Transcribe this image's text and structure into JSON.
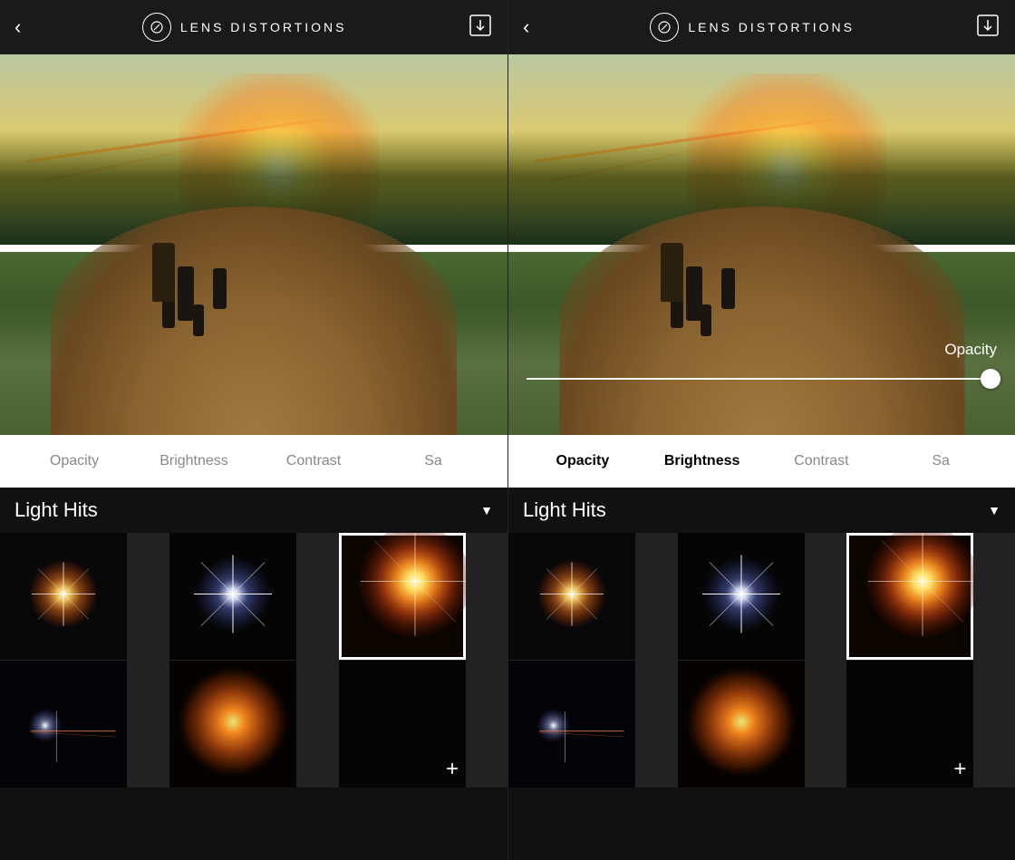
{
  "panels": [
    {
      "id": "panel-left",
      "header": {
        "back_label": "‹",
        "logo_icon": "✕",
        "title": "LENS DISTORTIONS",
        "download_icon": "⬇"
      },
      "controls": {
        "items": [
          {
            "label": "Opacity",
            "active": false
          },
          {
            "label": "Brightness",
            "active": false
          },
          {
            "label": "Contrast",
            "active": false
          },
          {
            "label": "Sa",
            "active": false
          }
        ]
      },
      "light_hits": {
        "title": "Light Hits",
        "dropdown_icon": "▼"
      },
      "thumbnails": [
        {
          "id": 1,
          "type": "small-star-warm",
          "selected": false
        },
        {
          "id": 2,
          "type": "small-star-white",
          "selected": false
        },
        {
          "id": 3,
          "type": "large-warm-burst",
          "selected": true
        },
        {
          "id": 4,
          "type": "streak-flare",
          "selected": false
        },
        {
          "id": 5,
          "type": "orange-glow",
          "selected": false
        },
        {
          "id": 6,
          "type": "add",
          "selected": false
        }
      ],
      "show_opacity_slider": false
    },
    {
      "id": "panel-right",
      "header": {
        "back_label": "‹",
        "logo_icon": "✕",
        "title": "LENS DISTORTIONS",
        "download_icon": "⬇"
      },
      "controls": {
        "items": [
          {
            "label": "Opacity",
            "active": true
          },
          {
            "label": "Brightness",
            "active": true
          },
          {
            "label": "Contrast",
            "active": false
          },
          {
            "label": "Sa",
            "active": false
          }
        ]
      },
      "light_hits": {
        "title": "Light Hits",
        "dropdown_icon": "▼"
      },
      "thumbnails": [
        {
          "id": 1,
          "type": "small-star-warm",
          "selected": false
        },
        {
          "id": 2,
          "type": "small-star-white",
          "selected": false
        },
        {
          "id": 3,
          "type": "large-warm-burst",
          "selected": true
        },
        {
          "id": 4,
          "type": "streak-flare",
          "selected": false
        },
        {
          "id": 5,
          "type": "orange-glow",
          "selected": false
        },
        {
          "id": 6,
          "type": "add",
          "selected": false
        }
      ],
      "show_opacity_slider": true,
      "opacity_label": "Opacity",
      "opacity_value": 95
    }
  ]
}
